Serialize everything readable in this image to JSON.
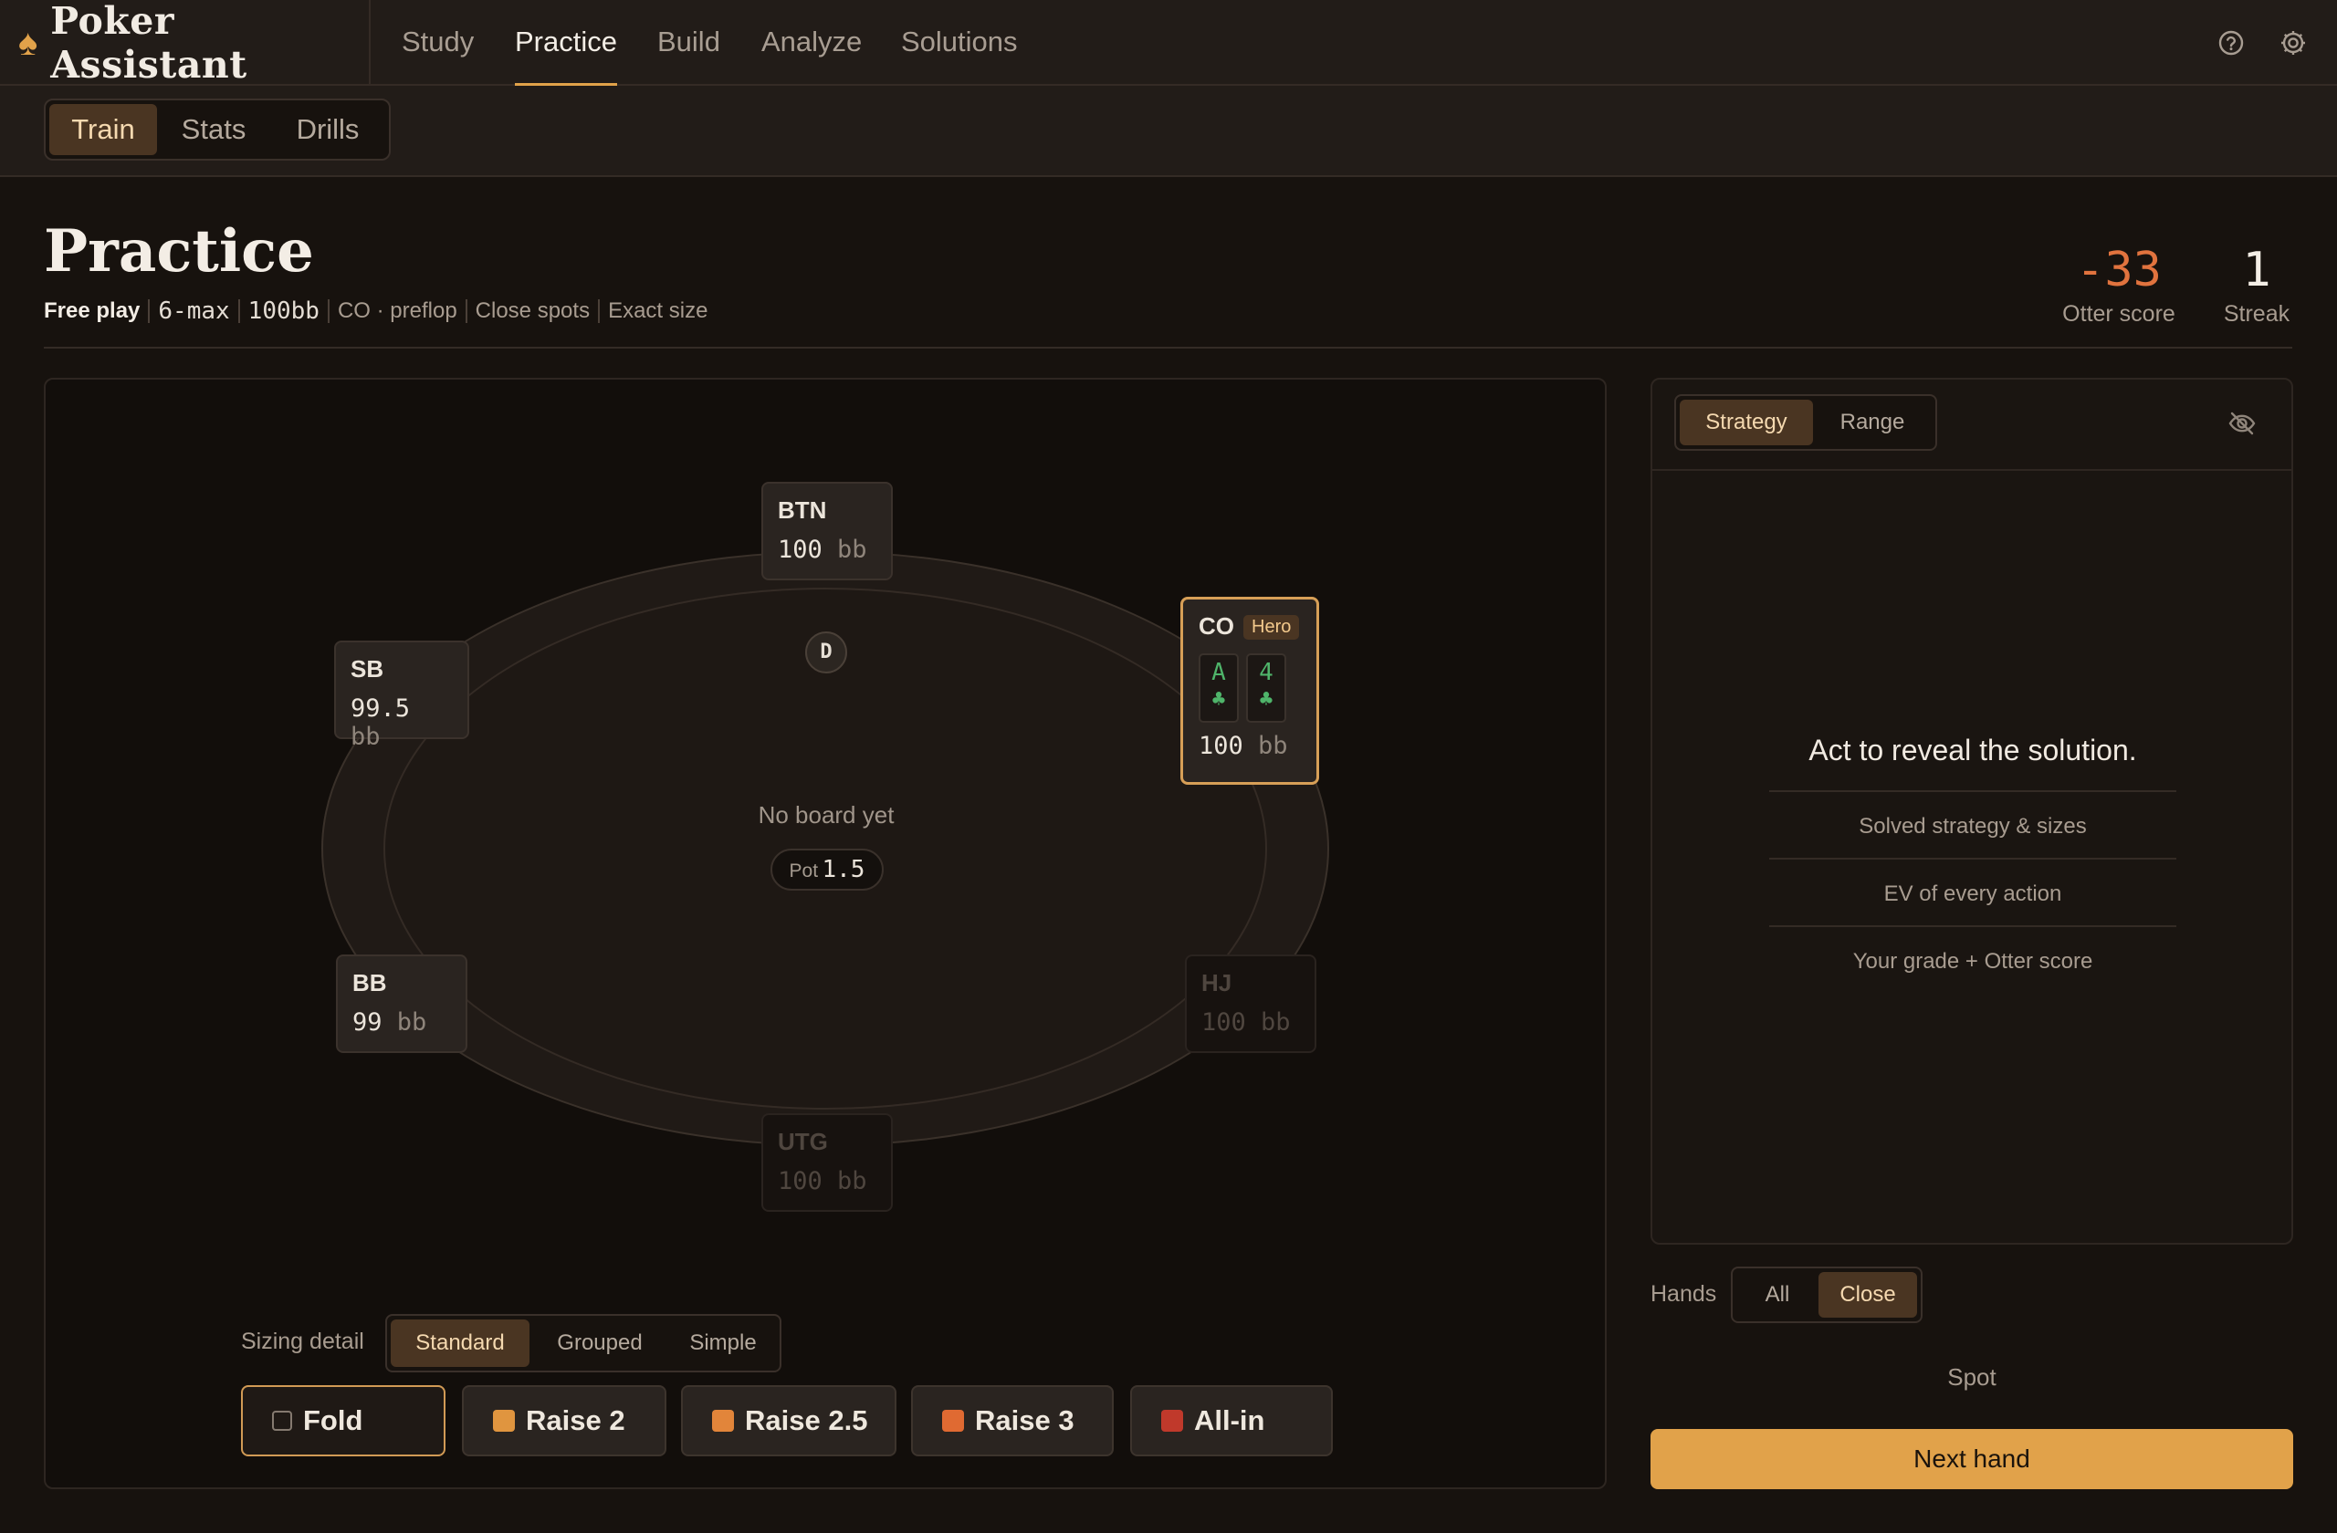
{
  "app": {
    "name": "Poker Assistant"
  },
  "nav": {
    "items": [
      {
        "label": "Study"
      },
      {
        "label": "Practice"
      },
      {
        "label": "Build"
      },
      {
        "label": "Analyze"
      },
      {
        "label": "Solutions"
      }
    ],
    "active": "Practice",
    "icons": [
      "help-icon",
      "settings-icon"
    ]
  },
  "subnav": {
    "tabs": [
      {
        "label": "Train"
      },
      {
        "label": "Stats"
      },
      {
        "label": "Drills"
      }
    ],
    "active": "Train"
  },
  "page": {
    "title": "Practice",
    "meta": {
      "mode": "Free play",
      "format": "6-max",
      "stack": "100bb",
      "spot": "CO · preflop",
      "filter": "Close spots",
      "sizing": "Exact size"
    },
    "otter_score": {
      "value": "-33",
      "label": "Otter score",
      "color": "#e1733e"
    },
    "streak": {
      "value": "1",
      "label": "Streak"
    }
  },
  "table": {
    "seats": {
      "btn": {
        "pos": "BTN",
        "stack": "100",
        "unit": "bb"
      },
      "sb": {
        "pos": "SB",
        "stack": "99.5",
        "unit": "bb"
      },
      "bb": {
        "pos": "BB",
        "stack": "99",
        "unit": "bb"
      },
      "co": {
        "pos": "CO",
        "stack": "100",
        "unit": "bb",
        "tag": "Hero",
        "cards": [
          {
            "rank": "A",
            "suit": "♣"
          },
          {
            "rank": "4",
            "suit": "♣"
          }
        ]
      },
      "hj": {
        "pos": "HJ",
        "stack": "100",
        "unit": "bb"
      },
      "utg": {
        "pos": "UTG",
        "stack": "100",
        "unit": "bb"
      }
    },
    "dealer": "D",
    "board_text": "No board yet",
    "pot_label": "Pot",
    "pot_value": "1.5"
  },
  "sizing": {
    "label": "Sizing detail",
    "options": [
      {
        "label": "Standard"
      },
      {
        "label": "Grouped"
      },
      {
        "label": "Simple"
      }
    ],
    "active": "Standard"
  },
  "actions": [
    {
      "label": "Fold",
      "color": ""
    },
    {
      "label": "Raise 2",
      "color": "#e0953f"
    },
    {
      "label": "Raise 2.5",
      "color": "#e2853a"
    },
    {
      "label": "Raise 3",
      "color": "#e06a32"
    },
    {
      "label": "All-in",
      "color": "#c0392b"
    }
  ],
  "solution": {
    "tabs": [
      {
        "label": "Strategy"
      },
      {
        "label": "Range"
      }
    ],
    "active": "Strategy",
    "reveal": "Act to reveal the solution.",
    "features": [
      "Solved strategy & sizes",
      "EV of every action",
      "Your grade + Otter score"
    ]
  },
  "hands": {
    "label": "Hands",
    "options": [
      {
        "label": "All"
      },
      {
        "label": "Close"
      }
    ],
    "active": "Close"
  },
  "spot_label": "Spot",
  "next_hand": "Next hand",
  "colors": {
    "accent": "#e1a24a",
    "background": "#17120e",
    "card_suit": "#4fb46a"
  }
}
